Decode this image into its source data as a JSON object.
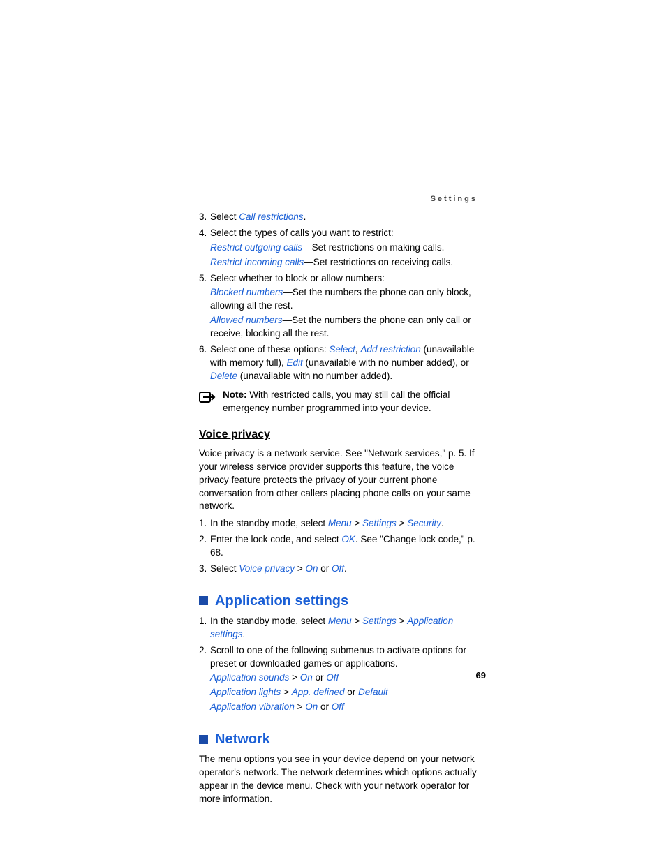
{
  "header": "Settings",
  "pageNumber": "69",
  "list1": {
    "i3": {
      "n": "3.",
      "pre": "Select ",
      "link": "Call restrictions",
      "post": "."
    },
    "i4": {
      "n": "4.",
      "line": "Select the types of calls you want to restrict:",
      "a_link": "Restrict outgoing calls",
      "a_post": "—Set restrictions on making calls.",
      "b_link": "Restrict incoming calls",
      "b_post": "—Set restrictions on receiving calls."
    },
    "i5": {
      "n": "5.",
      "line": "Select whether to block or allow numbers:",
      "a_link": "Blocked numbers",
      "a_post": "—Set the numbers the phone can only block, allowing all the rest.",
      "b_link": "Allowed numbers",
      "b_post": "—Set the numbers the phone can only call or receive, blocking all the rest."
    },
    "i6": {
      "n": "6.",
      "pre": "Select one of these options: ",
      "o1": "Select",
      "s1": ", ",
      "o2": "Add restriction",
      "s2": " (unavailable with memory full), ",
      "o3": "Edit",
      "s3": " (unavailable with no number added), or ",
      "o4": "Delete",
      "s4": " (unavailable with no number added)."
    }
  },
  "note": {
    "label": "Note: ",
    "text": "With restricted calls, you may still call the official emergency number programmed into your device."
  },
  "voicePrivacy": {
    "heading": "Voice privacy",
    "para": "Voice privacy is a network service. See \"Network services,\" p. 5. If your wireless service provider supports this feature, the voice privacy feature protects the privacy of your current phone conversation from other callers placing phone calls on your same network.",
    "i1": {
      "n": "1.",
      "pre": "In the standby mode, select ",
      "a": "Menu",
      "gt1": " > ",
      "b": "Settings",
      "gt2": " > ",
      "c": "Security",
      "post": "."
    },
    "i2": {
      "n": "2.",
      "pre": "Enter the lock code, and select ",
      "a": "OK",
      "post": ". See \"Change lock code,\" p. 68."
    },
    "i3": {
      "n": "3.",
      "pre": "Select ",
      "a": "Voice privacy",
      "gt1": " > ",
      "b": "On",
      "or": " or ",
      "c": "Off",
      "post": "."
    }
  },
  "appSettings": {
    "heading": "Application settings",
    "i1": {
      "n": "1.",
      "pre": "In the standby mode, select ",
      "a": "Menu",
      "gt1": " > ",
      "b": "Settings",
      "gt2": " > ",
      "c": "Application settings",
      "post": "."
    },
    "i2": {
      "n": "2.",
      "line": "Scroll to one of the following submenus to activate options for preset or downloaded games or applications.",
      "r1a": "Application sounds",
      "r1gt": " > ",
      "r1b": "On",
      "r1or": " or ",
      "r1c": "Off",
      "r2a": "Application lights",
      "r2gt": " > ",
      "r2b": "App. defined",
      "r2or": " or ",
      "r2c": "Default",
      "r3a": "Application vibration",
      "r3gt": " > ",
      "r3b": "On",
      "r3or": " or ",
      "r3c": "Off"
    }
  },
  "network": {
    "heading": "Network",
    "para": "The menu options you see in your device depend on your network operator's network. The network determines which options actually appear in the device menu. Check with your network operator for more information."
  }
}
